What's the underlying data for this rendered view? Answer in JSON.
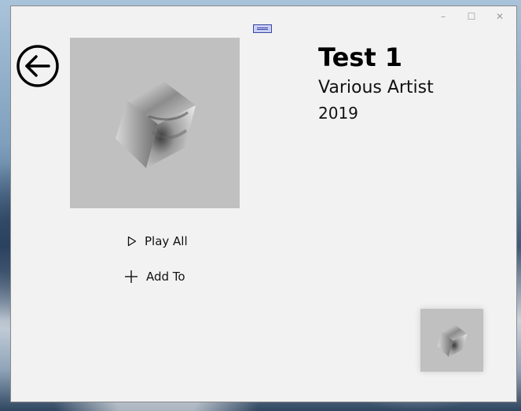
{
  "window": {
    "minimize_glyph": "–",
    "maximize_glyph": "☐",
    "close_glyph": "✕"
  },
  "album": {
    "title": "Test 1",
    "artist": "Various Artist",
    "year": "2019"
  },
  "actions": {
    "play_all_label": "Play All",
    "add_to_label": "Add To"
  },
  "icons": {
    "back": "arrow-left-circle-icon",
    "play": "play-outline-icon",
    "add": "plus-icon"
  },
  "colors": {
    "window_bg": "#f2f2f2",
    "cover_bg": "#c0c0c0",
    "drag_handle_border": "#3b47a8"
  }
}
